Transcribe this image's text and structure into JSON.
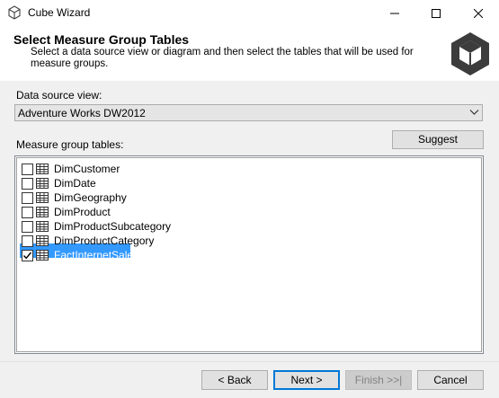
{
  "window": {
    "title": "Cube Wizard",
    "minimize_glyph": "—",
    "maximize_glyph": "□",
    "close_glyph": "✕"
  },
  "header": {
    "title": "Select Measure Group Tables",
    "description": "Select a data source view or diagram and then select the tables that will be used for measure groups."
  },
  "data_source": {
    "label": "Data source view:",
    "selected": "Adventure Works DW2012"
  },
  "measure_tables": {
    "label": "Measure group tables:",
    "suggest_label": "Suggest",
    "items": [
      {
        "label": "DimCustomer",
        "checked": false,
        "selected": false
      },
      {
        "label": "DimDate",
        "checked": false,
        "selected": false
      },
      {
        "label": "DimGeography",
        "checked": false,
        "selected": false
      },
      {
        "label": "DimProduct",
        "checked": false,
        "selected": false
      },
      {
        "label": "DimProductSubcategory",
        "checked": false,
        "selected": false
      },
      {
        "label": "DimProductCategory",
        "checked": false,
        "selected": false
      },
      {
        "label": "FactInternetSales",
        "checked": true,
        "selected": true
      }
    ]
  },
  "footer": {
    "back_label": "< Back",
    "next_label": "Next >",
    "finish_label": "Finish >>|",
    "cancel_label": "Cancel"
  },
  "colors": {
    "selection": "#3399ff",
    "dialog_bg": "#f0f0f0",
    "default_button_border": "#0078d7"
  }
}
